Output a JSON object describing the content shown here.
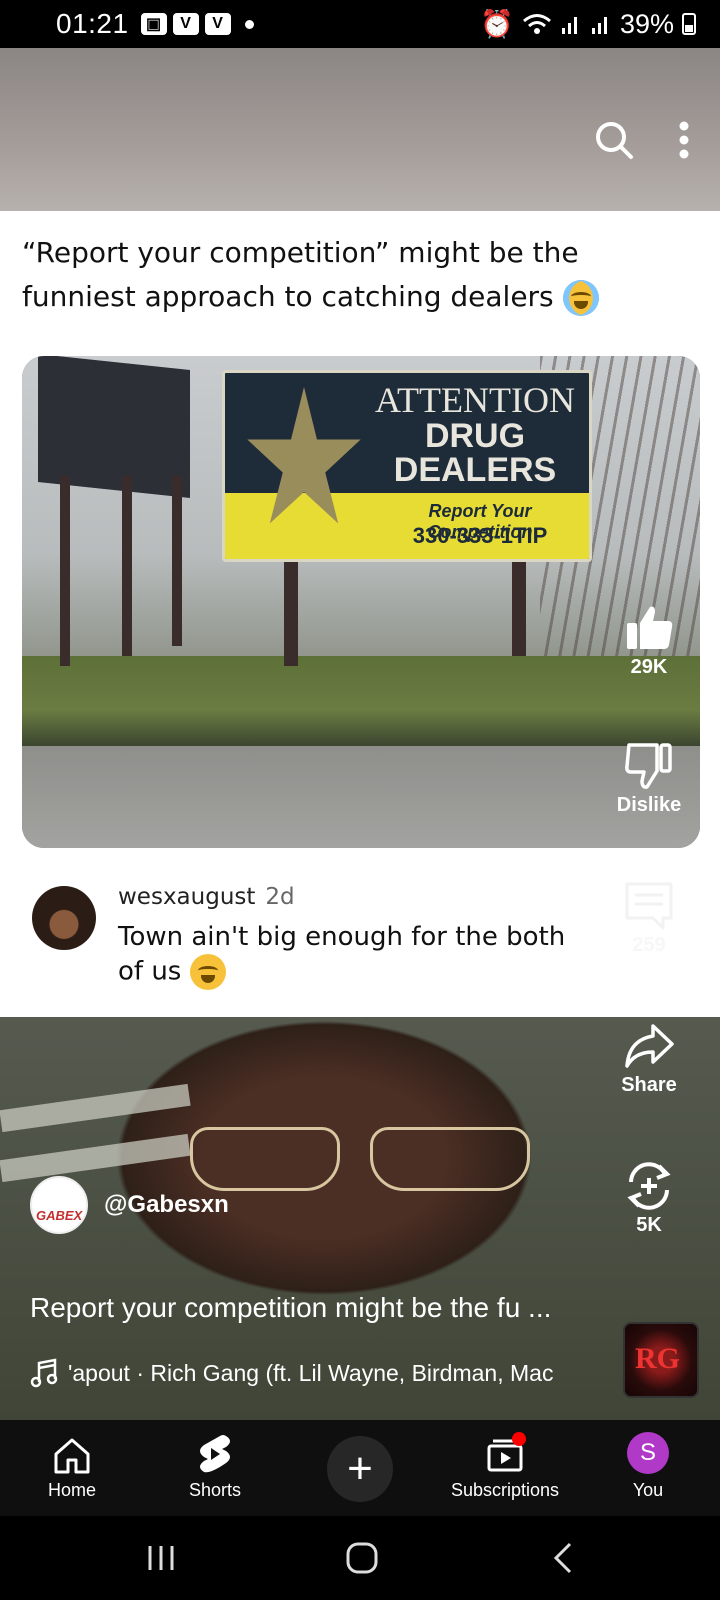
{
  "status_bar": {
    "time": "01:21",
    "battery": "39%",
    "left_icons": [
      "image-icon",
      "v-icon",
      "v-icon",
      "dot"
    ],
    "right_icons": [
      "alarm-icon",
      "wifi-icon",
      "signal-icon",
      "signal-icon",
      "battery-icon"
    ]
  },
  "post": {
    "text": "“Report your competition” might be the funniest approach to catching dealers",
    "image_sign": {
      "title": "ATTENTION",
      "line2": "DRUG",
      "line3": "DEALERS",
      "report": "Report Your Competition",
      "phone": "330-333-1TIP"
    }
  },
  "comment": {
    "user": "wesxaugust",
    "time": "2d",
    "text": "Town ain't big enough for the both of us"
  },
  "actions": {
    "like_count": "29K",
    "dislike_label": "Dislike",
    "comment_count": "259",
    "share_label": "Share",
    "remix_count": "5K"
  },
  "channel": {
    "avatar_text": "GABEX",
    "handle": "@Gabesxn"
  },
  "caption": "Report your competition might be the fu ...",
  "music": {
    "track": "'apout · Rich Gang (ft. Lil Wayne, Birdman, Mac"
  },
  "album_art_text": "RG",
  "nav": {
    "home": "Home",
    "shorts": "Shorts",
    "subscriptions": "Subscriptions",
    "you": "You",
    "you_initial": "S"
  },
  "colors": {
    "accent_red": "#ff0000",
    "you_avatar": "#b039c8",
    "nav_bg": "#0f0f0f"
  }
}
